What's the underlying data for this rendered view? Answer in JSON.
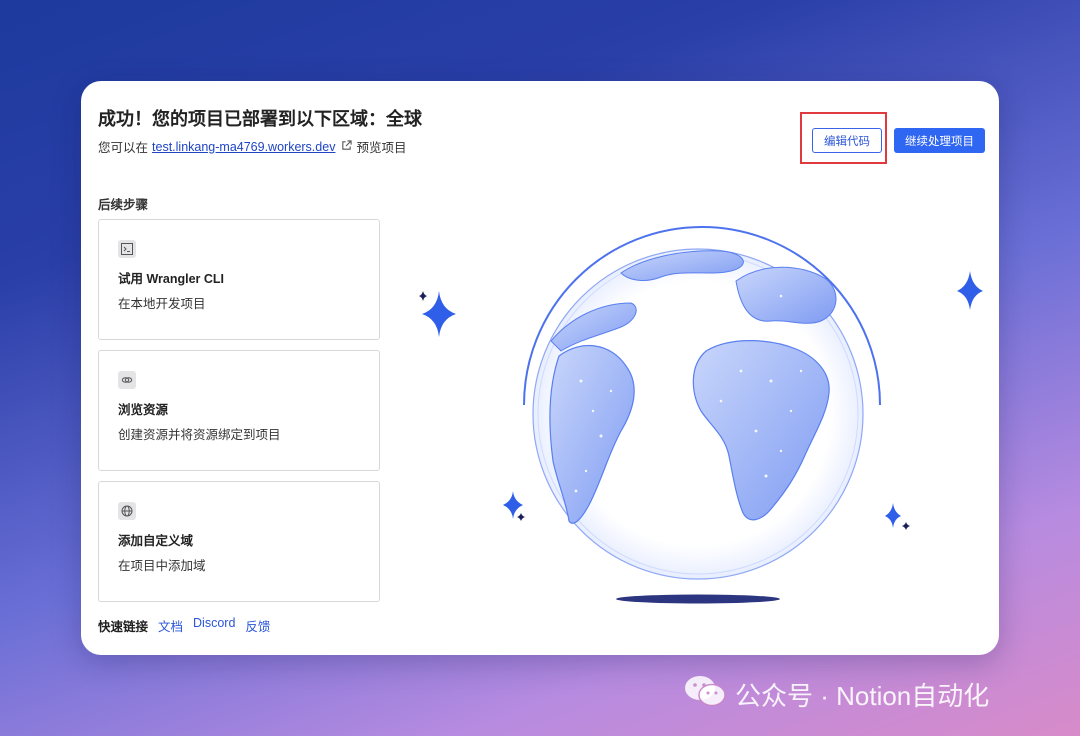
{
  "header": {
    "title": "成功！您的项目已部署到以下区域：全球",
    "subtitle_prefix": "您可以在",
    "url": "test.linkang-ma4769.workers.dev",
    "subtitle_suffix": "预览项目"
  },
  "actions": {
    "edit_code": "编辑代码",
    "continue_project": "继续处理项目"
  },
  "steps": {
    "heading": "后续步骤",
    "items": [
      {
        "title": "试用 Wrangler CLI",
        "desc": "在本地开发项目",
        "icon": "terminal-icon"
      },
      {
        "title": "浏览资源",
        "desc": "创建资源并将资源绑定到项目",
        "icon": "link-icon"
      },
      {
        "title": "添加自定义域",
        "desc": "在项目中添加域",
        "icon": "globe-icon"
      }
    ]
  },
  "quick_links": {
    "label": "快速链接",
    "links": [
      "文档",
      "Discord",
      "反馈"
    ]
  },
  "watermark": {
    "text": "公众号 · Notion自动化"
  },
  "colors": {
    "accent": "#2f66f2",
    "highlight": "#e0393e",
    "globe": "#5a7ff0"
  }
}
